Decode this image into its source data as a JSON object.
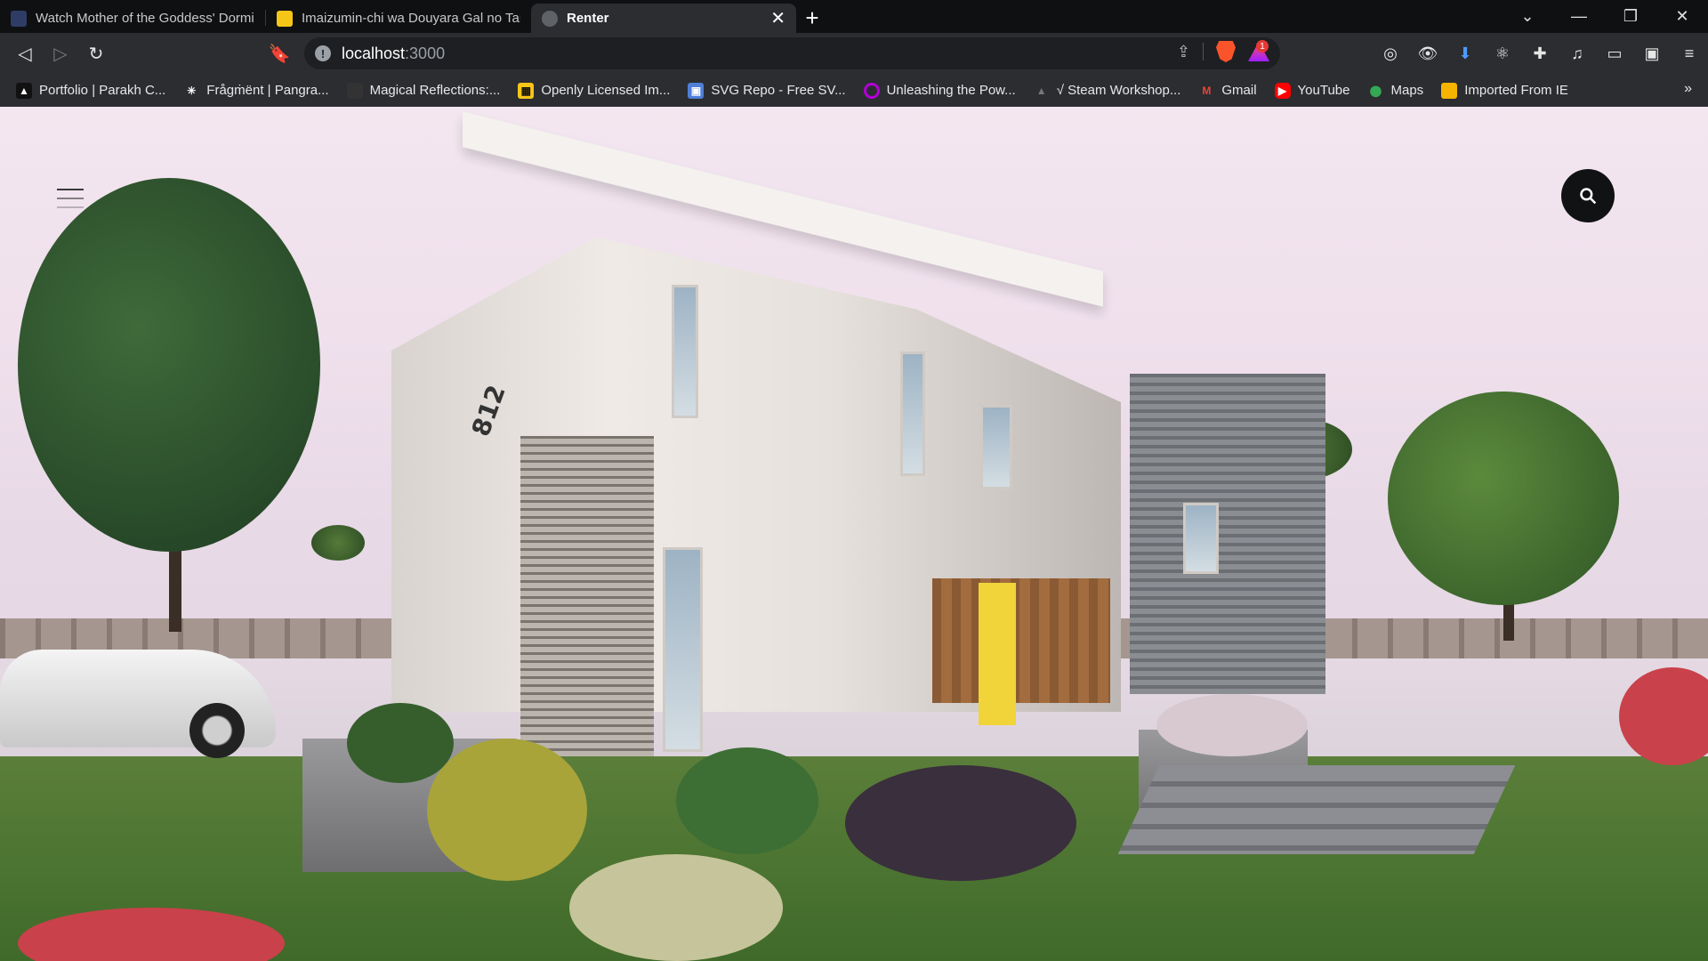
{
  "tabs": [
    {
      "title": "Watch Mother of the Goddess' Dormitory",
      "favicon_color": "#2f3d66"
    },
    {
      "title": "Imaizumin-chi wa Douyara Gal no Tamariba",
      "favicon_color": "#f5c518"
    },
    {
      "title": "Renter",
      "favicon_color": "#5f6368",
      "active": true
    }
  ],
  "toolbar": {
    "url_host": "localhost",
    "url_port": ":3000",
    "brave_badge_count": "1"
  },
  "bookmarks": [
    {
      "label": "Portfolio | Parakh C...",
      "icon_color": "#111111"
    },
    {
      "label": "Frågṁënt | Pangra...",
      "icon_color": "#222222"
    },
    {
      "label": "Magical Reflections:...",
      "icon_color": "#333333"
    },
    {
      "label": "Openly Licensed Im...",
      "icon_color": "#f5c518"
    },
    {
      "label": "SVG Repo - Free SV...",
      "icon_color": "#4f7fd8"
    },
    {
      "label": "Unleashing the Pow...",
      "icon_color": "#b300d6"
    },
    {
      "label": "√ Steam Workshop...",
      "icon_color": "#444444"
    },
    {
      "label": "Gmail",
      "icon_color": "#ea4335"
    },
    {
      "label": "YouTube",
      "icon_color": "#ff0000"
    },
    {
      "label": "Maps",
      "icon_color": "#34a853"
    },
    {
      "label": "Imported From IE",
      "icon_color": "#f4b400"
    }
  ],
  "page": {
    "house_number": "812"
  },
  "colors": {
    "door_accent": "#f0d43a",
    "search_button_bg": "#111214"
  }
}
